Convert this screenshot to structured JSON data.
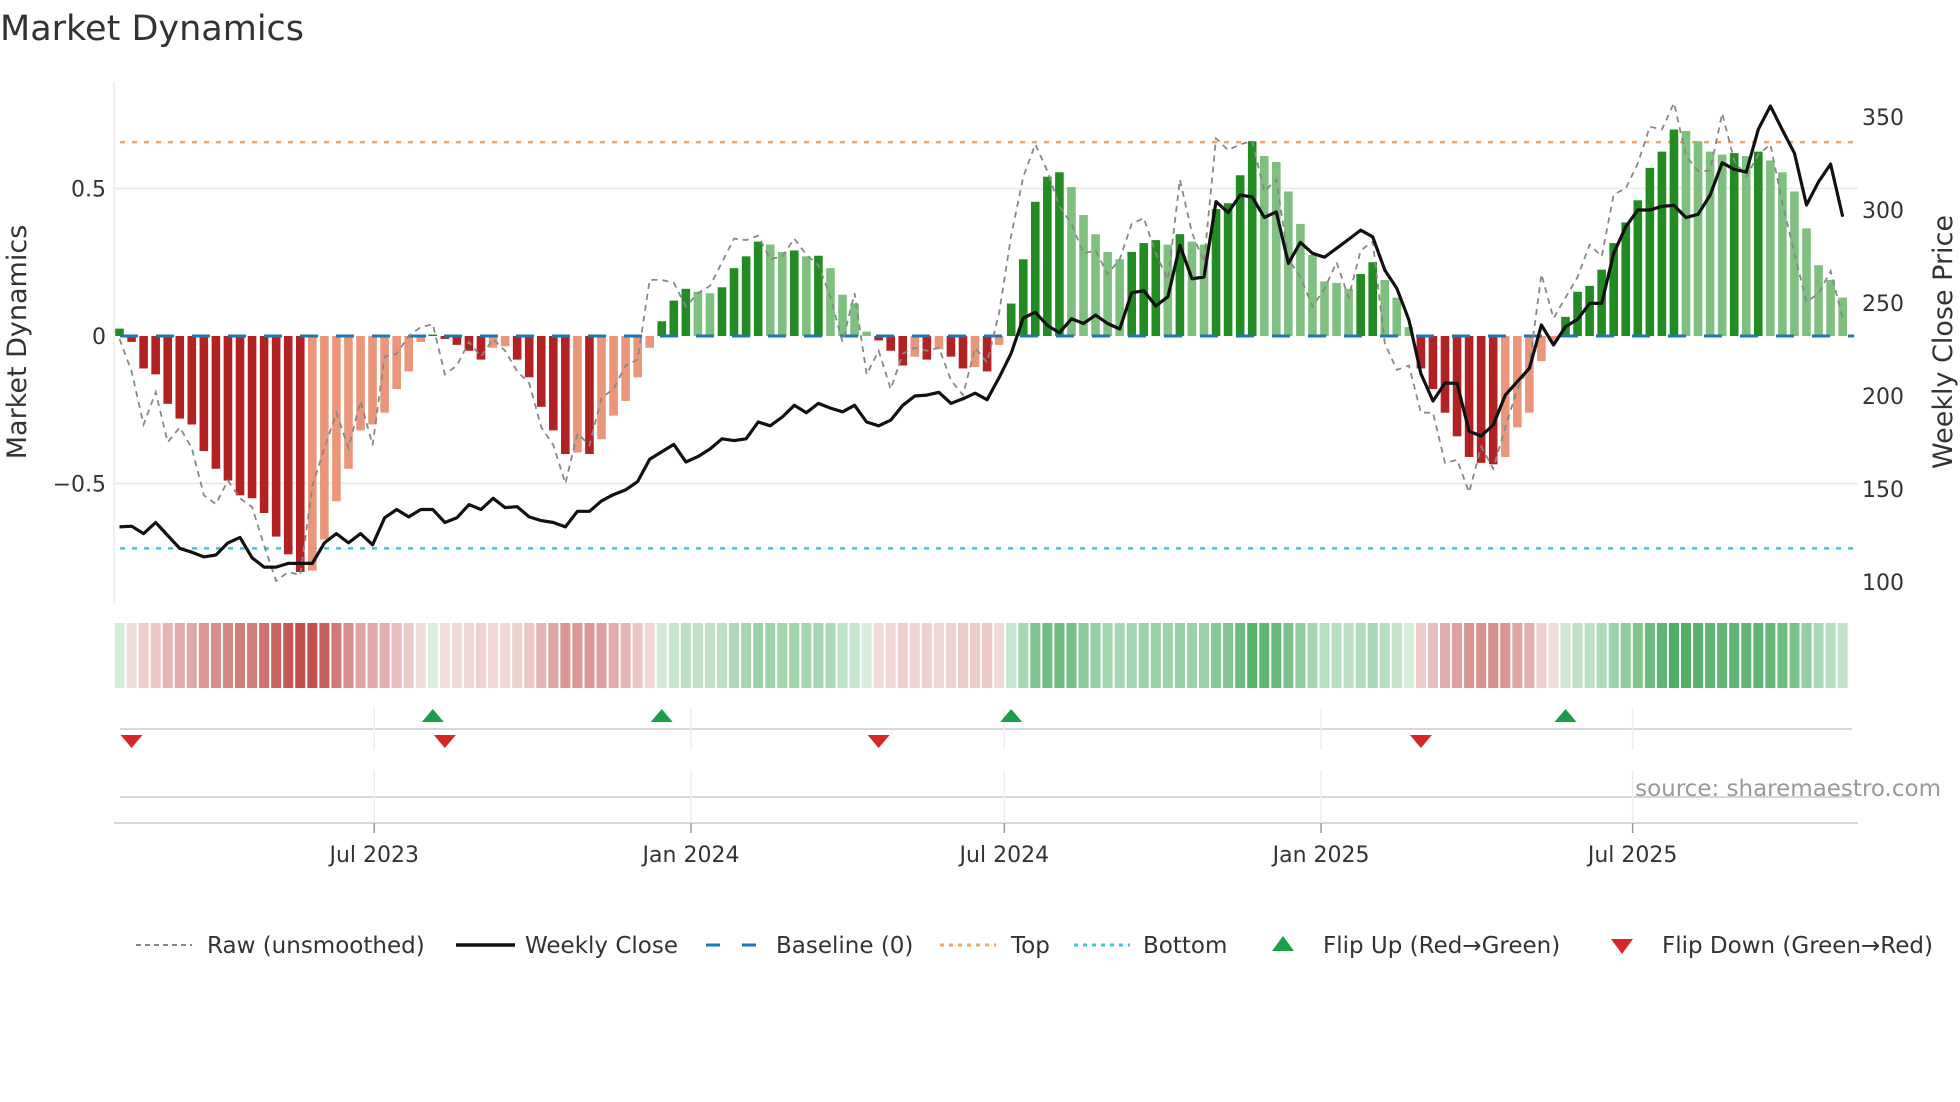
{
  "title": "Market Dynamics",
  "source": "source: sharemaestro.com",
  "chart_data": {
    "type": "bar",
    "title": "Market Dynamics",
    "ylabel": "Market Dynamics",
    "y2label": "Weekly Close Price",
    "ylim": [
      -0.86,
      0.87
    ],
    "y2lim": [
      88,
      372
    ],
    "yticks": [
      {
        "v": 0.5,
        "label": "0.5"
      },
      {
        "v": 0,
        "label": "0"
      },
      {
        "v": -0.5,
        "label": "−0.5"
      }
    ],
    "y2ticks": [
      {
        "v": 350,
        "label": "350"
      },
      {
        "v": 300,
        "label": "300"
      },
      {
        "v": 250,
        "label": "250"
      },
      {
        "v": 200,
        "label": "200"
      },
      {
        "v": 150,
        "label": "150"
      },
      {
        "v": 100,
        "label": "100"
      }
    ],
    "x_start": "2023-02-03",
    "x_step_days": 7,
    "xticks": [
      {
        "date": "2023-07-01",
        "label": "Jul 2023"
      },
      {
        "date": "2024-01-01",
        "label": "Jan 2024"
      },
      {
        "date": "2024-07-01",
        "label": "Jul 2024"
      },
      {
        "date": "2025-01-01",
        "label": "Jan 2025"
      },
      {
        "date": "2025-07-01",
        "label": "Jul 2025"
      }
    ],
    "top_level": 0.657,
    "bottom_level": -0.72,
    "baseline": 0,
    "colors": {
      "up_strong": "#228b22",
      "up_weak": "#7fbf7f",
      "down_strong": "#b22222",
      "down_weak": "#e9967a",
      "close": "#111111",
      "raw": "#888888",
      "baseline": "#1f77b4",
      "top": "#f4a46a",
      "bottom": "#3ec8d8",
      "flip_up": "#1a9e48",
      "flip_down": "#d62728"
    },
    "series": [
      {
        "name": "Market Dynamics",
        "values": [
          0.025,
          -0.02,
          -0.11,
          -0.13,
          -0.23,
          -0.28,
          -0.3,
          -0.39,
          -0.45,
          -0.49,
          -0.54,
          -0.55,
          -0.6,
          -0.68,
          -0.74,
          -0.8,
          -0.795,
          -0.69,
          -0.56,
          -0.45,
          -0.32,
          -0.3,
          -0.26,
          -0.18,
          -0.12,
          -0.02,
          0.005,
          -0.01,
          -0.03,
          -0.05,
          -0.08,
          -0.04,
          -0.035,
          -0.08,
          -0.14,
          -0.24,
          -0.32,
          -0.4,
          -0.395,
          -0.4,
          -0.35,
          -0.27,
          -0.22,
          -0.14,
          -0.04,
          0.05,
          0.12,
          0.16,
          0.15,
          0.145,
          0.165,
          0.23,
          0.27,
          0.32,
          0.31,
          0.285,
          0.29,
          0.27,
          0.272,
          0.23,
          0.14,
          0.11,
          0.015,
          -0.015,
          -0.05,
          -0.1,
          -0.07,
          -0.08,
          -0.045,
          -0.07,
          -0.11,
          -0.105,
          -0.12,
          -0.03,
          0.11,
          0.26,
          0.455,
          0.54,
          0.555,
          0.505,
          0.41,
          0.345,
          0.285,
          0.26,
          0.285,
          0.315,
          0.325,
          0.31,
          0.345,
          0.32,
          0.31,
          0.43,
          0.45,
          0.545,
          0.66,
          0.61,
          0.59,
          0.49,
          0.38,
          0.275,
          0.185,
          0.18,
          0.16,
          0.21,
          0.25,
          0.19,
          0.13,
          0.03,
          -0.11,
          -0.18,
          -0.26,
          -0.34,
          -0.41,
          -0.43,
          -0.435,
          -0.41,
          -0.31,
          -0.26,
          -0.085,
          -0.02,
          0.065,
          0.15,
          0.17,
          0.225,
          0.315,
          0.385,
          0.46,
          0.57,
          0.625,
          0.7,
          0.695,
          0.66,
          0.625,
          0.615,
          0.62,
          0.61,
          0.625,
          0.595,
          0.555,
          0.49,
          0.365,
          0.24,
          0.19,
          0.13
        ]
      },
      {
        "name": "Raw (unsmoothed)",
        "values": [
          -0.01,
          -0.12,
          -0.3,
          -0.19,
          -0.36,
          -0.31,
          -0.38,
          -0.54,
          -0.57,
          -0.49,
          -0.55,
          -0.58,
          -0.71,
          -0.83,
          -0.8,
          -0.81,
          -0.51,
          -0.38,
          -0.26,
          -0.38,
          -0.22,
          -0.37,
          -0.07,
          -0.06,
          0.0,
          0.03,
          0.04,
          -0.13,
          -0.1,
          -0.02,
          -0.07,
          -0.01,
          -0.05,
          -0.12,
          -0.16,
          -0.31,
          -0.37,
          -0.5,
          -0.33,
          -0.37,
          -0.21,
          -0.18,
          -0.1,
          -0.08,
          0.19,
          0.19,
          0.18,
          0.1,
          0.145,
          0.17,
          0.25,
          0.33,
          0.325,
          0.34,
          0.26,
          0.27,
          0.33,
          0.275,
          0.24,
          0.13,
          -0.02,
          0.145,
          -0.13,
          -0.05,
          -0.18,
          -0.06,
          -0.04,
          -0.05,
          -0.04,
          -0.15,
          -0.2,
          -0.04,
          -0.09,
          0.08,
          0.34,
          0.54,
          0.65,
          0.56,
          0.44,
          0.38,
          0.28,
          0.29,
          0.21,
          0.26,
          0.38,
          0.4,
          0.28,
          0.19,
          0.53,
          0.35,
          0.25,
          0.67,
          0.63,
          0.65,
          0.66,
          0.49,
          0.53,
          0.26,
          0.2,
          0.1,
          0.16,
          0.25,
          0.13,
          0.29,
          0.32,
          -0.025,
          -0.115,
          -0.1,
          -0.26,
          -0.26,
          -0.43,
          -0.42,
          -0.53,
          -0.375,
          -0.45,
          -0.31,
          -0.18,
          -0.1,
          0.21,
          0.06,
          0.13,
          0.2,
          0.31,
          0.27,
          0.48,
          0.5,
          0.585,
          0.71,
          0.7,
          0.79,
          0.61,
          0.56,
          0.56,
          0.755,
          0.595,
          0.54,
          0.615,
          0.65,
          0.45,
          0.28,
          0.115,
          0.145,
          0.22,
          0.06
        ]
      },
      {
        "name": "Weekly Close",
        "axis": "right",
        "values": [
          129.6,
          130,
          126,
          132,
          125,
          118,
          116,
          113.5,
          114.5,
          121,
          124,
          113,
          108,
          108,
          110,
          110,
          110,
          121,
          126,
          121,
          126,
          120,
          134.5,
          139,
          135,
          139,
          139,
          132,
          134.5,
          141.6,
          139,
          145,
          140,
          140.5,
          135,
          133,
          132,
          129.6,
          138,
          138,
          143.6,
          147,
          149.5,
          154,
          166,
          170,
          174,
          164.5,
          167.4,
          171.5,
          177,
          176,
          177,
          186,
          184,
          188.7,
          195,
          191,
          196,
          193.5,
          191.5,
          195,
          186,
          184,
          187,
          195,
          200,
          200.5,
          202,
          196,
          198.5,
          201.5,
          198,
          210,
          223,
          242,
          245,
          238,
          234,
          241.5,
          239,
          243.5,
          239,
          236,
          255.5,
          256.6,
          248.4,
          253.4,
          281,
          263,
          264,
          304.5,
          298.6,
          308,
          307,
          296,
          299,
          271.3,
          282.6,
          276.7,
          274.6,
          279.4,
          284.2,
          289.2,
          285.6,
          267.7,
          257.9,
          240.9,
          212,
          197.3,
          207,
          206.8,
          181,
          178.5,
          184.4,
          200.5,
          207.7,
          214.9,
          238.2,
          227.4,
          237.3,
          241.2,
          249.8,
          249.8,
          276.7,
          291,
          300,
          300,
          302,
          302.5,
          295.9,
          297.7,
          308,
          325.4,
          321.9,
          320.4,
          343.4,
          355.9,
          343,
          330.5,
          302.7,
          315.2,
          324.7,
          296.4
        ]
      }
    ],
    "flip_up_weeks": [
      27,
      46,
      75,
      121
    ],
    "flip_down_weeks": [
      2,
      28,
      64,
      109
    ],
    "legend": {
      "placement": "bottom",
      "items": [
        {
          "key": "raw",
          "label": "Raw (unsmoothed)"
        },
        {
          "key": "close",
          "label": "Weekly Close"
        },
        {
          "key": "baseline",
          "label": "Baseline (0)"
        },
        {
          "key": "top",
          "label": "Top"
        },
        {
          "key": "bottom",
          "label": "Bottom"
        },
        {
          "key": "flip_up",
          "label": "Flip Up (Red→Green)"
        },
        {
          "key": "flip_down",
          "label": "Flip Down (Green→Red)"
        }
      ]
    }
  }
}
